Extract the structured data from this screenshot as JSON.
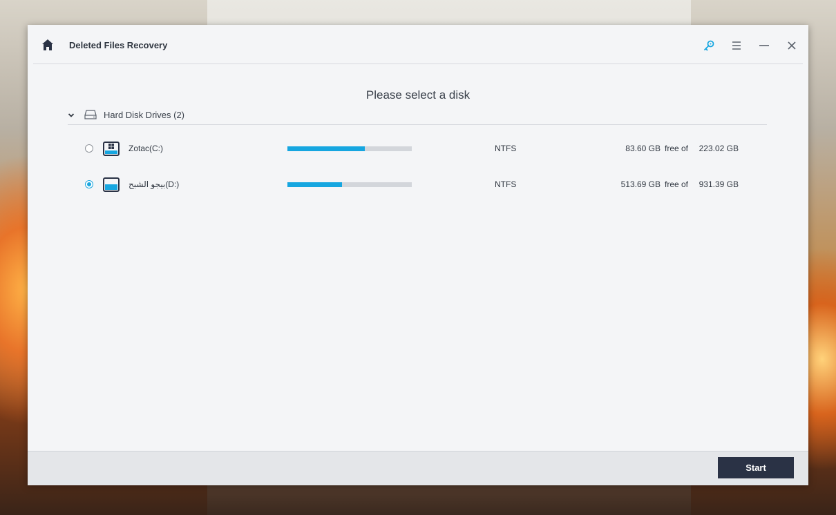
{
  "app": {
    "title": "Deleted Files Recovery"
  },
  "toolbar": {
    "icons": [
      "home-icon",
      "key-icon",
      "menu-icon",
      "minimize-icon",
      "close-icon"
    ],
    "accent_color": "#16a6e0"
  },
  "main": {
    "heading": "Please select a disk",
    "group": {
      "label": "Hard Disk Drives (2)",
      "expanded": true
    },
    "disks": [
      {
        "name": "Zotac(C:)",
        "filesystem": "NTFS",
        "free": "83.60 GB",
        "free_of_label": "free of",
        "total": "223.02 GB",
        "selected": false,
        "used_fraction": 0.62,
        "icon": "windows-drive-icon"
      },
      {
        "name": "بيجو الشبح(D:)",
        "filesystem": "NTFS",
        "free": "513.69 GB",
        "free_of_label": "free of",
        "total": "931.39 GB",
        "selected": true,
        "used_fraction": 0.44,
        "icon": "drive-icon"
      }
    ]
  },
  "footer": {
    "start_label": "Start",
    "start_color": "#2a3245"
  }
}
